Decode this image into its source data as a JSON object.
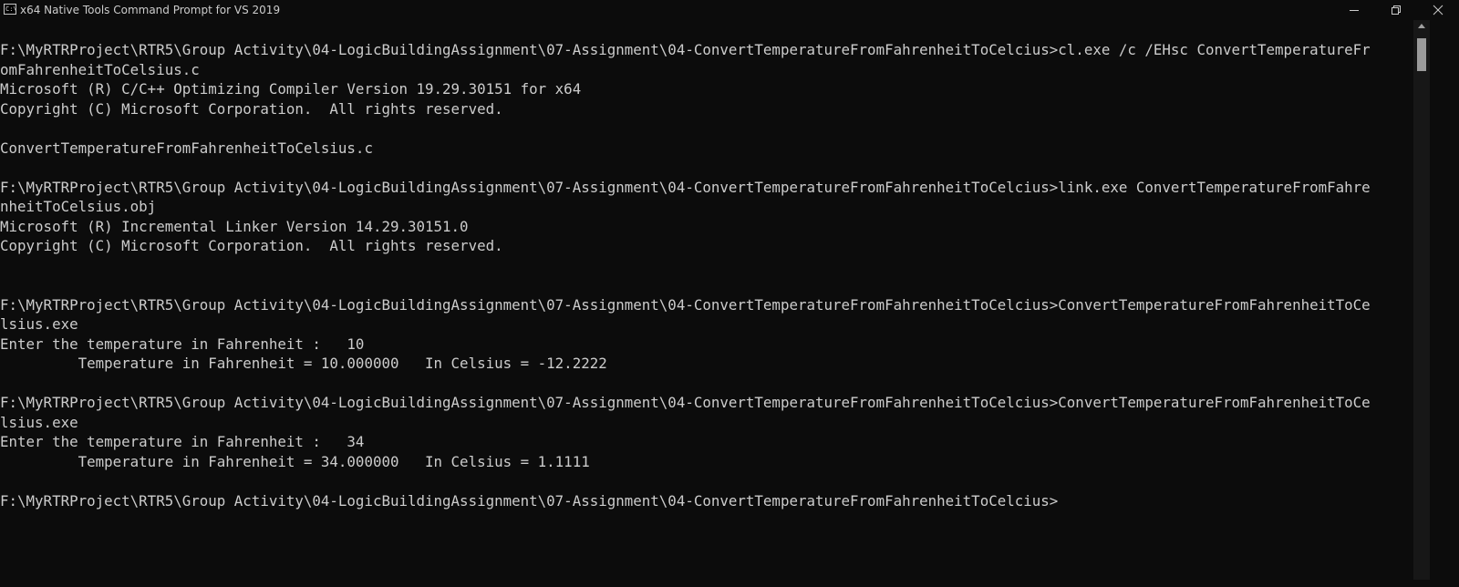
{
  "window": {
    "title": "x64 Native Tools Command Prompt for VS 2019",
    "icon_text": "C:\\",
    "background_color": "#0c0c0c",
    "text_color": "#cccccc"
  },
  "controls": {
    "minimize_icon": "minimize-icon",
    "restore_icon": "restore-icon",
    "close_icon": "close-icon"
  },
  "console": {
    "lines": [
      "F:\\MyRTRProject\\RTR5\\Group Activity\\04-LogicBuildingAssignment\\07-Assignment\\04-ConvertTemperatureFromFahrenheitToCelcius>cl.exe /c /EHsc ConvertTemperatureFr",
      "omFahrenheitToCelsius.c",
      "Microsoft (R) C/C++ Optimizing Compiler Version 19.29.30151 for x64",
      "Copyright (C) Microsoft Corporation.  All rights reserved.",
      "",
      "ConvertTemperatureFromFahrenheitToCelsius.c",
      "",
      "F:\\MyRTRProject\\RTR5\\Group Activity\\04-LogicBuildingAssignment\\07-Assignment\\04-ConvertTemperatureFromFahrenheitToCelcius>link.exe ConvertTemperatureFromFahre",
      "nheitToCelsius.obj",
      "Microsoft (R) Incremental Linker Version 14.29.30151.0",
      "Copyright (C) Microsoft Corporation.  All rights reserved.",
      "",
      "",
      "F:\\MyRTRProject\\RTR5\\Group Activity\\04-LogicBuildingAssignment\\07-Assignment\\04-ConvertTemperatureFromFahrenheitToCelcius>ConvertTemperatureFromFahrenheitToCe",
      "lsius.exe",
      "Enter the temperature in Fahrenheit :   10",
      "         Temperature in Fahrenheit = 10.000000   In Celsius = -12.2222",
      "",
      "F:\\MyRTRProject\\RTR5\\Group Activity\\04-LogicBuildingAssignment\\07-Assignment\\04-ConvertTemperatureFromFahrenheitToCelcius>ConvertTemperatureFromFahrenheitToCe",
      "lsius.exe",
      "Enter the temperature in Fahrenheit :   34",
      "         Temperature in Fahrenheit = 34.000000   In Celsius = 1.1111",
      "",
      "F:\\MyRTRProject\\RTR5\\Group Activity\\04-LogicBuildingAssignment\\07-Assignment\\04-ConvertTemperatureFromFahrenheitToCelcius>"
    ]
  }
}
